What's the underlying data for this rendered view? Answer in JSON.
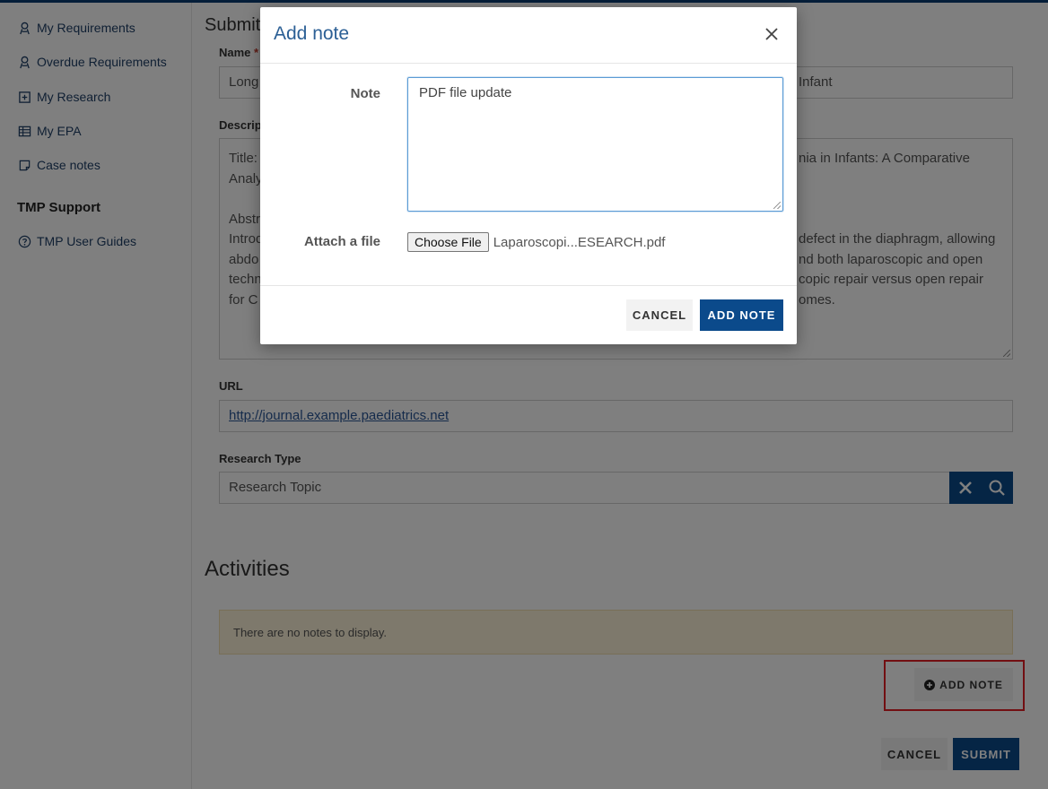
{
  "sidebar": {
    "items": [
      {
        "label": "My Requirements",
        "icon": "requirements-icon"
      },
      {
        "label": "Overdue Requirements",
        "icon": "overdue-requirements-icon"
      },
      {
        "label": "My Research",
        "icon": "research-icon"
      },
      {
        "label": "My EPA",
        "icon": "epa-table-icon"
      },
      {
        "label": "Case notes",
        "icon": "case-notes-icon"
      }
    ],
    "support_heading": "TMP Support",
    "support_items": [
      {
        "label": "TMP User Guides",
        "icon": "help-circle-icon"
      }
    ]
  },
  "form": {
    "heading": "Submit",
    "name_label": "Name",
    "name_required_marker": "*",
    "name_value_left": "Long",
    "name_value_right": "Infant",
    "description_label": "Descrip",
    "description_lines_left": [
      "Title:",
      "Analy",
      "",
      "Abstr",
      "Introd",
      "abdo",
      "techn",
      "for C"
    ],
    "description_lines_right": [
      "nia in Infants: A Comparative",
      "",
      "",
      "",
      "defect in the diaphragm, allowing",
      "nd both laparoscopic and open",
      "copic repair versus open repair",
      "omes."
    ],
    "url_label": "URL",
    "url_value": "http://journal.example.paediatrics.net",
    "research_type_label": "Research Type",
    "research_type_value": "Research Topic"
  },
  "activities": {
    "title": "Activities",
    "empty_message": "There are no notes to display.",
    "add_note_label": "ADD NOTE"
  },
  "footer": {
    "cancel_label": "CANCEL",
    "submit_label": "SUBMIT"
  },
  "modal": {
    "title": "Add note",
    "note_label": "Note",
    "note_value": "PDF file update",
    "attach_label": "Attach a file",
    "choose_file_label": "Choose File",
    "file_name": "Laparoscopi...ESEARCH.pdf",
    "cancel_label": "CANCEL",
    "add_note_label": "ADD NOTE"
  },
  "colors": {
    "primary": "#0b4a8b",
    "highlight": "#e51f24",
    "alert_bg": "#fcf2d8"
  }
}
